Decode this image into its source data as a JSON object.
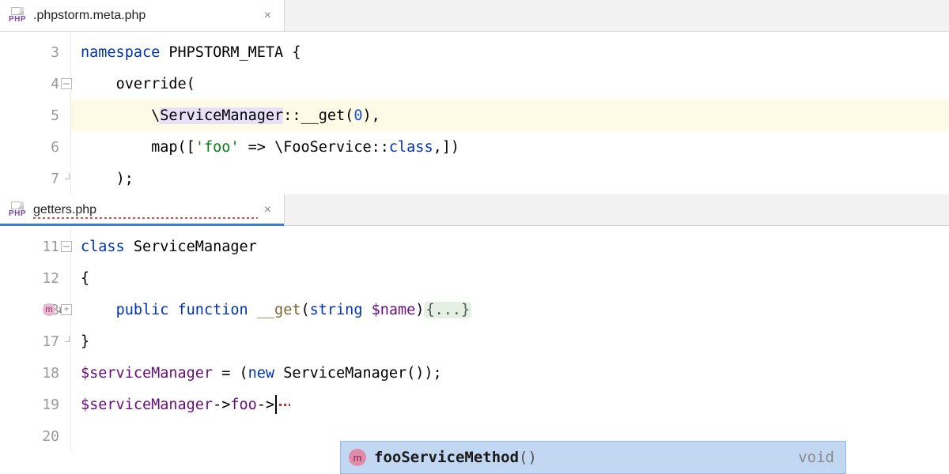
{
  "top": {
    "tab": {
      "icon_label": "PHP",
      "filename": ".phpstorm.meta.php"
    },
    "lines": {
      "3": {
        "n": "3"
      },
      "4": {
        "n": "4"
      },
      "5": {
        "n": "5"
      },
      "6": {
        "n": "6"
      },
      "7": {
        "n": "7"
      }
    },
    "code": {
      "l3_kw": "namespace",
      "l3_rest": " PHPSTORM_META {",
      "l4_indent": "    ",
      "l4_fn": "override",
      "l4_rest": "(",
      "l5_indent": "        ",
      "l5_bs": "\\",
      "l5_type": "ServiceManager",
      "l5_sep": "::",
      "l5_meth": "__get",
      "l5_open": "(",
      "l5_arg": "0",
      "l5_close": "),",
      "l6_indent": "        ",
      "l6_fn": "map",
      "l6_a": "([",
      "l6_str": "'foo'",
      "l6_arrow": " => ",
      "l6_bs": "\\",
      "l6_cls": "FooService",
      "l6_sep": "::",
      "l6_kw": "class",
      "l6_end": ",])",
      "l7_indent": "    ",
      "l7_end": ");"
    }
  },
  "bottom": {
    "tab": {
      "icon_label": "PHP",
      "filename": "getters.php"
    },
    "lines": {
      "11": {
        "n": "11"
      },
      "12": {
        "n": "12"
      },
      "13": {
        "n": "13"
      },
      "17": {
        "n": "17"
      },
      "18": {
        "n": "18"
      },
      "19": {
        "n": "19"
      },
      "20": {
        "n": "20"
      }
    },
    "code": {
      "l11_kw": "class",
      "l11_name": " ServiceManager",
      "l12_brace": "{",
      "l13_indent": "    ",
      "l13_kw1": "public",
      "l13_kw2": " function ",
      "l13_meth": "__get",
      "l13_open": "(",
      "l13_kwtype": "string ",
      "l13_var": "$name",
      "l13_close": ")",
      "l13_fold": "{...}",
      "l17_close": "}",
      "l18_var": "$serviceManager",
      "l18_eq": " = (",
      "l18_kw": "new ",
      "l18_cls": "ServiceManager",
      "l18_end": "());",
      "l19_var": "$serviceManager",
      "l19_arrow": "->",
      "l19_field": "foo",
      "l19_arrow2": "->",
      "l20": ""
    }
  },
  "autocomplete": {
    "badge": "m",
    "name": "fooServiceMethod",
    "paren": "()",
    "return_type": "void"
  },
  "icons": {
    "method_badge": "m",
    "method_arrow": "↓"
  }
}
